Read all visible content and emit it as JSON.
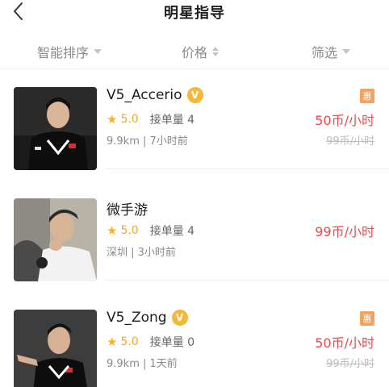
{
  "header": {
    "title": "明星指导",
    "back_icon": "chevron-left-icon"
  },
  "filters": [
    {
      "label": "智能排序",
      "icon": "caret-down-icon"
    },
    {
      "label": "价格",
      "icon": "sort-icon"
    },
    {
      "label": "筛选",
      "icon": "caret-down-icon"
    }
  ],
  "colors": {
    "price": "#f04848",
    "rating": "#f5a623",
    "verified": "#f4b83b",
    "promo": "#f2a35d"
  },
  "coaches": [
    {
      "name": "V5_Accerio",
      "verified_badge": "V",
      "star_icon": "★",
      "rating": "5.0",
      "orders": "接单量 4",
      "meta": "9.9km | 7小时前",
      "promo_badge": "惠",
      "price": "50币/小时",
      "original_price": "99币/小时"
    },
    {
      "name": "微手游",
      "star_icon": "★",
      "rating": "5.0",
      "orders": "接单量 4",
      "meta": "深圳 | 3小时前",
      "price": "99币/小时"
    },
    {
      "name": "V5_Zong",
      "verified_badge": "V",
      "star_icon": "★",
      "rating": "5.0",
      "orders": "接单量 0",
      "meta": "9.9km | 1天前",
      "promo_badge": "惠",
      "price": "50币/小时",
      "original_price": "99币/小时"
    }
  ]
}
